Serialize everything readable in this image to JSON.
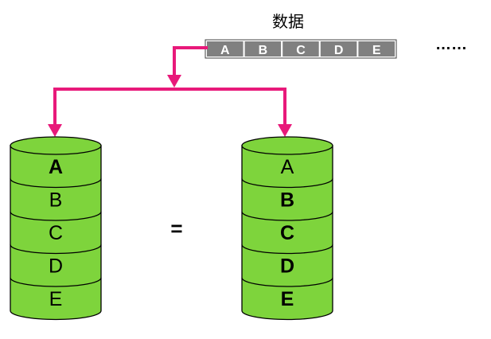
{
  "title": "数据",
  "data_blocks": [
    "A",
    "B",
    "C",
    "D",
    "E"
  ],
  "ellipsis": "……",
  "equals": "=",
  "left_disk": {
    "segments": [
      {
        "label": "A",
        "bold": true
      },
      {
        "label": "B",
        "bold": false
      },
      {
        "label": "C",
        "bold": false
      },
      {
        "label": "D",
        "bold": false
      },
      {
        "label": "E",
        "bold": false
      }
    ]
  },
  "right_disk": {
    "segments": [
      {
        "label": "A",
        "bold": false
      },
      {
        "label": "B",
        "bold": true
      },
      {
        "label": "C",
        "bold": true
      },
      {
        "label": "D",
        "bold": true
      },
      {
        "label": "E",
        "bold": true
      }
    ]
  },
  "colors": {
    "arrow": "#e8197a",
    "disk_fill": "#7ed43c",
    "disk_stroke": "#000000",
    "block_fill": "#808080",
    "block_text": "#ffffff"
  }
}
